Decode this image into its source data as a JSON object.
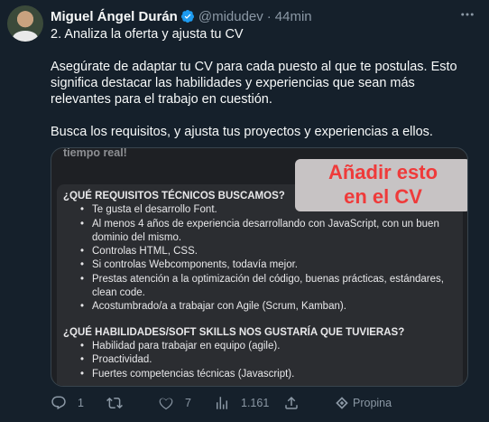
{
  "tweet": {
    "author_name": "Miguel Ángel Durán",
    "handle": "@midudev",
    "separator": "·",
    "time": "44min",
    "lines": {
      "l1": "2. Analiza la oferta y ajusta tu CV",
      "l2": "Asegúrate de adaptar tu CV para cada puesto al que te postulas. Esto significa destacar las habilidades y experiencias que sean más relevantes para el trabajo en cuestión.",
      "l3": "Busca los requisitos, y ajusta tus proyectos y experiencias a ellos."
    }
  },
  "media": {
    "cutoff_text": "tiempo real!",
    "stamp_line1": "Añadir esto",
    "stamp_line2": "en el CV",
    "section1_title": "¿QUÉ REQUISITOS TÉCNICOS BUSCAMOS?",
    "section1_items": [
      "Te gusta el desarrollo Font.",
      "Al menos 4 años de experiencia desarrollando con JavaScript, con un buen dominio del mismo.",
      "Controlas HTML, CSS.",
      "Si controlas Webcomponents, todavía mejor.",
      "Prestas atención a la optimización del código, buenas prácticas, estándares, clean code.",
      "Acostumbrado/a a trabajar con Agile (Scrum, Kamban)."
    ],
    "section2_title": "¿QUÉ HABILIDADES/SOFT SKILLS NOS GUSTARÍA QUE TUVIERAS?",
    "section2_items": [
      "Habilidad para trabajar en equipo (agile).",
      "Proactividad.",
      "Fuertes competencias técnicas (Javascript)."
    ]
  },
  "actions": {
    "reply_count": "1",
    "retweet_count": "",
    "like_count": "7",
    "views_count": "1.161",
    "tip_label": "Propina"
  },
  "colors": {
    "background": "#15202b",
    "verified": "#1d9bf0",
    "stamp_text": "#ef3a3a",
    "muted": "#8b98a5"
  },
  "icons": [
    "verified-badge-icon",
    "more-icon",
    "reply-icon",
    "retweet-icon",
    "like-icon",
    "views-icon",
    "tip-icon"
  ]
}
